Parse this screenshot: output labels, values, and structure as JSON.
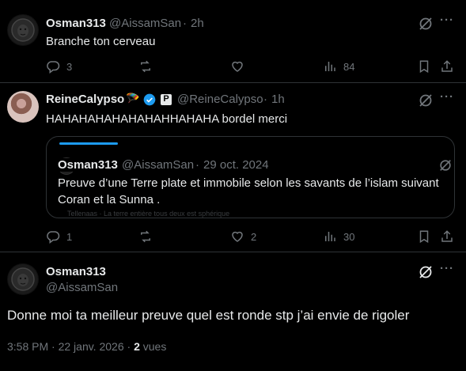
{
  "tweet1": {
    "name": "Osman313",
    "handle": "@AissamSan",
    "time": "2h",
    "text": "Branche ton cerveau",
    "replies": "3",
    "likes": "",
    "views": "84"
  },
  "tweet2": {
    "name": "ReineCalypso",
    "emoji": "🪂",
    "badge_letter": "P",
    "handle": "@ReineCalypso",
    "time": "1h",
    "text": "HAHAHAHAHAHAHAHHAHAHA bordel merci",
    "replies": "1",
    "likes": "2",
    "views": "30",
    "quote": {
      "name": "Osman313",
      "handle": "@AissamSan",
      "date": "29 oct. 2024",
      "line1": "Preuve d’une Terre plate et immobile selon les savants de l’islam suivant",
      "line2": "Coran et la Sunna .",
      "faded": "Tellenaas · La terre entière tous deux est sphérique"
    }
  },
  "main_tweet": {
    "name": "Osman313",
    "handle": "@AissamSan",
    "text": "Donne moi ta meilleur preuve quel est ronde stp j’ai envie de rigoler",
    "timestamp": "3:58 PM · 22 janv. 2026 · ",
    "views_count": "2",
    "views_label": " vues"
  },
  "sep": "·",
  "more": "···",
  "colors": {
    "background": "#000000",
    "text": "#e7e9ea",
    "muted": "#71767b",
    "accent": "#1d9bf0",
    "border": "#2f3336"
  }
}
